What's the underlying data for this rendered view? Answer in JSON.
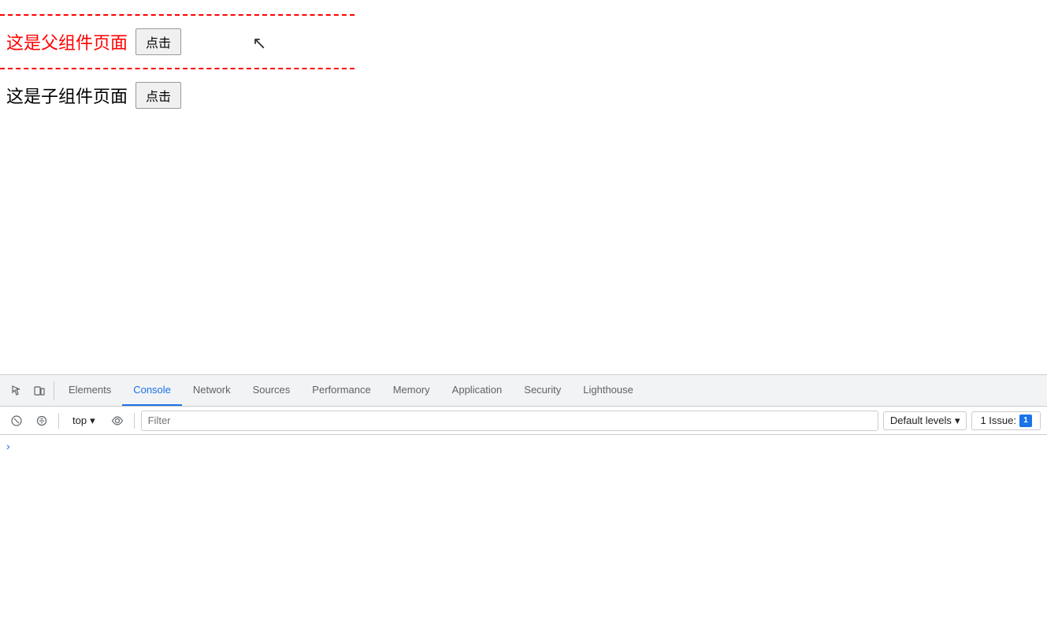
{
  "page": {
    "cursor_symbol": "↖"
  },
  "main": {
    "parent_text": "这是父组件页面",
    "parent_button": "点击",
    "child_text": "这是子组件页面",
    "child_button": "点击"
  },
  "devtools": {
    "tabs": [
      {
        "id": "elements",
        "label": "Elements",
        "active": false
      },
      {
        "id": "console",
        "label": "Console",
        "active": true
      },
      {
        "id": "network",
        "label": "Network",
        "active": false
      },
      {
        "id": "sources",
        "label": "Sources",
        "active": false
      },
      {
        "id": "performance",
        "label": "Performance",
        "active": false
      },
      {
        "id": "memory",
        "label": "Memory",
        "active": false
      },
      {
        "id": "application",
        "label": "Application",
        "active": false
      },
      {
        "id": "security",
        "label": "Security",
        "active": false
      },
      {
        "id": "lighthouse",
        "label": "Lighthouse",
        "active": false
      }
    ],
    "console_toolbar": {
      "top_label": "top",
      "dropdown_arrow": "▾",
      "filter_placeholder": "Filter",
      "default_levels_label": "Default levels",
      "default_levels_arrow": "▾",
      "issue_label": "1 Issue:",
      "issue_count": "1"
    }
  }
}
